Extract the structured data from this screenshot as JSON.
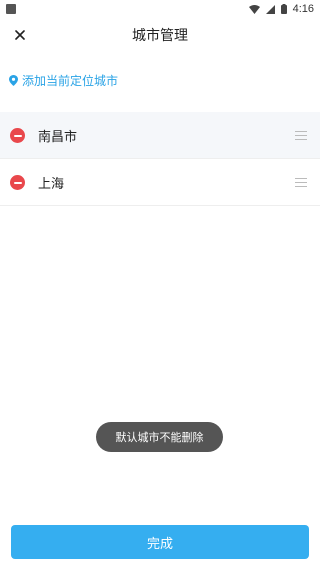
{
  "status_bar": {
    "time": "4:16"
  },
  "header": {
    "title": "城市管理",
    "close_icon": "close-icon"
  },
  "locate": {
    "label": "添加当前定位城市",
    "icon": "location-pin-icon",
    "color": "#2aa3e6"
  },
  "cities": [
    {
      "name": "南昌市"
    },
    {
      "name": "上海"
    }
  ],
  "toast": {
    "message": "默认城市不能删除"
  },
  "footer": {
    "done_label": "完成",
    "accent": "#35aef0"
  },
  "colors": {
    "remove": "#e9484c",
    "toast_bg": "#555555"
  }
}
